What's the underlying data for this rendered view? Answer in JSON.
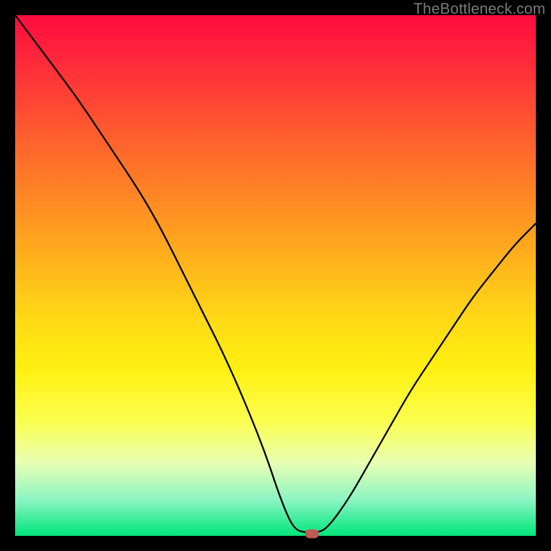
{
  "watermark": "TheBottleneck.com",
  "chart_data": {
    "type": "line",
    "title": "",
    "xlabel": "",
    "ylabel": "",
    "xlim": [
      0,
      100
    ],
    "ylim": [
      0,
      100
    ],
    "x": [
      0,
      6,
      12,
      18,
      24,
      28,
      32,
      36,
      40,
      44,
      48,
      51,
      53.5,
      56,
      58,
      60,
      64,
      68,
      72,
      76,
      80,
      84,
      88,
      92,
      96,
      100
    ],
    "values": [
      100,
      92,
      84,
      75,
      66,
      59,
      51,
      43,
      35,
      26,
      16,
      7,
      1.2,
      0.6,
      0.6,
      1.5,
      7,
      14,
      21,
      28,
      34,
      40,
      46,
      51,
      56,
      60
    ],
    "marker": {
      "x": 57,
      "y": 0.4
    },
    "gradient_stops": [
      {
        "pos": 0,
        "color": "#ff0b3e"
      },
      {
        "pos": 10,
        "color": "#ff2d3a"
      },
      {
        "pos": 22,
        "color": "#ff5a2f"
      },
      {
        "pos": 34,
        "color": "#ff8425"
      },
      {
        "pos": 46,
        "color": "#ffae1d"
      },
      {
        "pos": 58,
        "color": "#ffd816"
      },
      {
        "pos": 68,
        "color": "#fff011"
      },
      {
        "pos": 78,
        "color": "#fbff4f"
      },
      {
        "pos": 86,
        "color": "#e8ffb4"
      },
      {
        "pos": 93,
        "color": "#8cf5c2"
      },
      {
        "pos": 100,
        "color": "#00e57a"
      }
    ]
  }
}
